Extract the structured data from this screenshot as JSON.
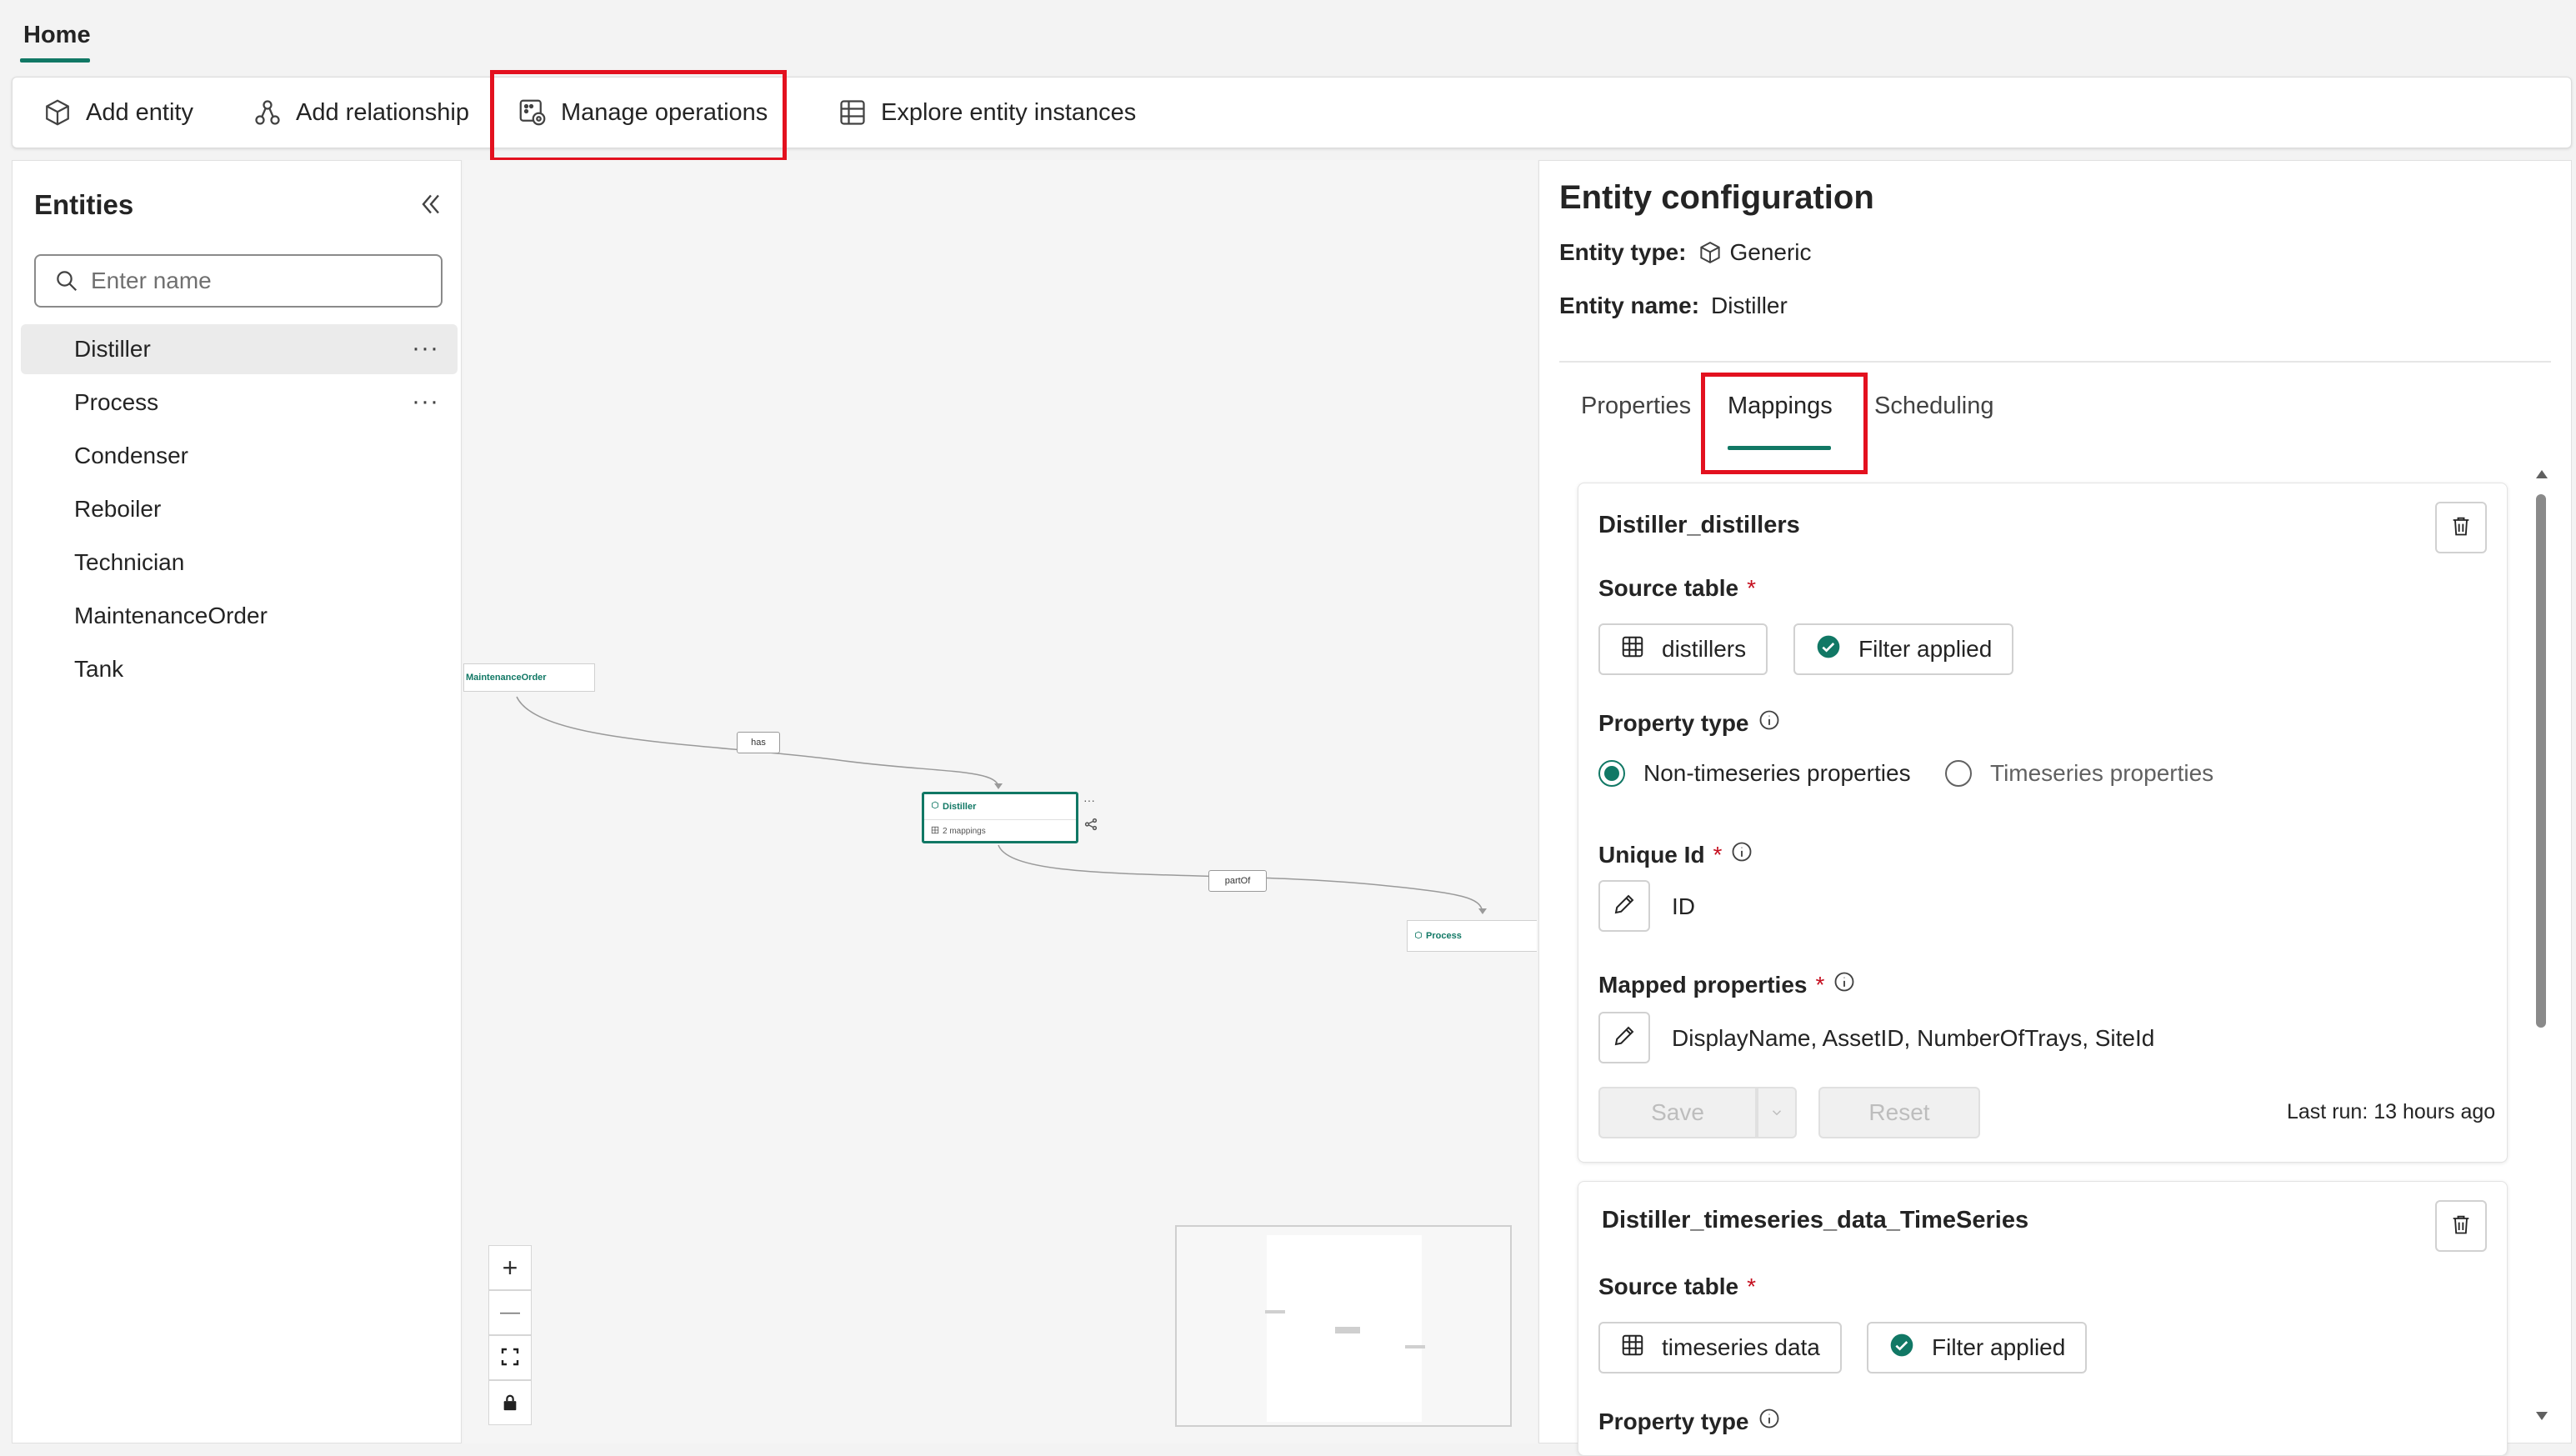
{
  "header": {
    "home_tab": "Home"
  },
  "toolbar": {
    "add_entity": "Add entity",
    "add_relationship": "Add relationship",
    "manage_operations": "Manage operations",
    "explore_entity_instances": "Explore entity instances"
  },
  "entities_panel": {
    "title": "Entities",
    "search_placeholder": "Enter name",
    "items": [
      {
        "label": "Distiller",
        "selected": true,
        "more": "···"
      },
      {
        "label": "Process",
        "more": "···"
      },
      {
        "label": "Condenser"
      },
      {
        "label": "Reboiler"
      },
      {
        "label": "Technician"
      },
      {
        "label": "MaintenanceOrder"
      },
      {
        "label": "Tank"
      }
    ]
  },
  "canvas": {
    "nodes": {
      "maintenance_order": "MaintenanceOrder",
      "distiller": "Distiller",
      "distiller_mappings": "2 mappings",
      "process": "Process"
    },
    "edges": {
      "has": "has",
      "part_of": "partOf"
    },
    "zoom_controls": {
      "zoom_in": "+",
      "zoom_out": "—"
    }
  },
  "config": {
    "title": "Entity configuration",
    "entity_type_label": "Entity type:",
    "entity_type_value": "Generic",
    "entity_name_label": "Entity name:",
    "entity_name_value": "Distiller",
    "tabs": {
      "properties": "Properties",
      "mappings": "Mappings",
      "scheduling": "Scheduling"
    },
    "card1": {
      "title": "Distiller_distillers",
      "source_table_label": "Source table",
      "source_table_value": "distillers",
      "filter_label": "Filter applied",
      "property_type_label": "Property type",
      "radio_non_ts": "Non-timeseries properties",
      "radio_ts": "Timeseries properties",
      "unique_id_label": "Unique Id",
      "unique_id_value": "ID",
      "mapped_props_label": "Mapped properties",
      "mapped_props_value": "DisplayName, AssetID, NumberOfTrays, SiteId",
      "save": "Save",
      "reset": "Reset",
      "last_run": "Last run: 13 hours ago"
    },
    "card2": {
      "title": "Distiller_timeseries_data_TimeSeries",
      "source_table_label": "Source table",
      "source_table_value": "timeseries data",
      "filter_label": "Filter applied",
      "property_type_label": "Property type"
    },
    "required_mark": "*"
  },
  "colors": {
    "accent": "#117865",
    "highlight": "#e3111f"
  }
}
